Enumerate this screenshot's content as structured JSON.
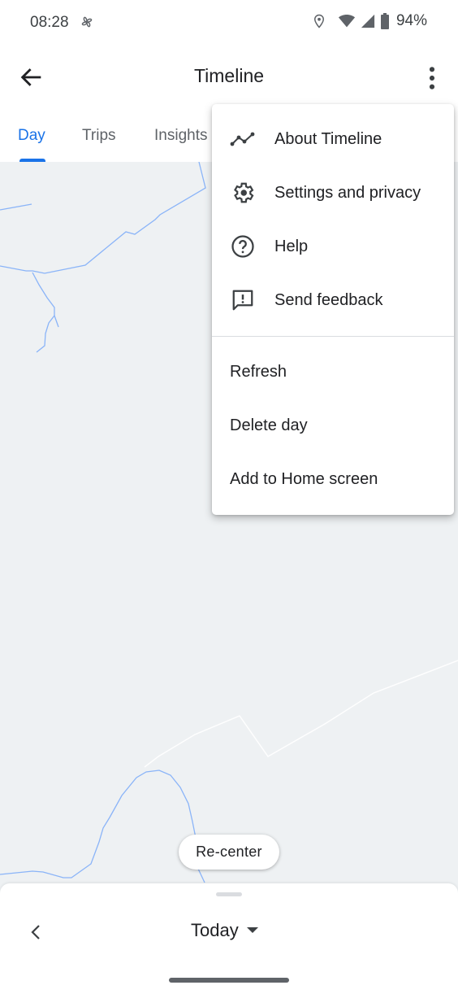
{
  "status_bar": {
    "time": "08:28",
    "battery_percent": "94%",
    "icons": [
      "fan-icon",
      "location-icon",
      "wifi-icon",
      "signal-icon",
      "battery-icon"
    ]
  },
  "app_bar": {
    "title": "Timeline",
    "back_icon": "arrow-back-icon",
    "more_icon": "more-vert-icon"
  },
  "tabs": [
    {
      "label": "Day",
      "active": true
    },
    {
      "label": "Trips",
      "active": false
    },
    {
      "label": "Insights",
      "active": false
    }
  ],
  "colors": {
    "accent": "#1a73e8",
    "map_background": "#eef1f3",
    "road_blue": "#8ab4f8",
    "text_primary": "#202124",
    "text_secondary": "#5f6368"
  },
  "overflow_menu": {
    "items": [
      {
        "label": "About Timeline",
        "icon": "timeline-icon"
      },
      {
        "label": "Settings and privacy",
        "icon": "gear-icon"
      },
      {
        "label": "Help",
        "icon": "help-icon"
      },
      {
        "label": "Send feedback",
        "icon": "feedback-icon"
      }
    ],
    "secondary_items": [
      {
        "label": "Refresh"
      },
      {
        "label": "Delete day"
      },
      {
        "label": "Add to Home screen"
      }
    ]
  },
  "map": {
    "recenter_label": "Re-center"
  },
  "bottom_sheet": {
    "date_label": "Today",
    "prev_icon": "chevron-left-icon",
    "dropdown_icon": "arrow-drop-down-icon"
  }
}
